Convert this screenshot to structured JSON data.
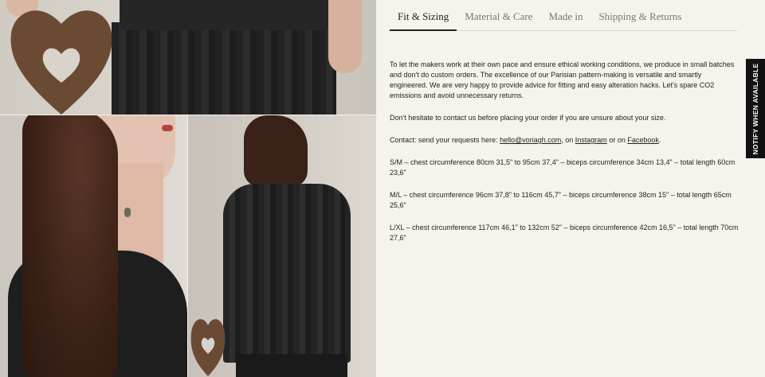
{
  "tabs": [
    {
      "label": "Fit & Sizing"
    },
    {
      "label": "Material & Care"
    },
    {
      "label": "Made in"
    },
    {
      "label": "Shipping & Returns"
    }
  ],
  "content": {
    "intro": "To let the makers work at their own pace and ensure ethical working conditions, we produce in small batches and don't do custom orders. The excellence of our Parisian pattern-making is versatile and smartly engineered. We are very happy to provide advice for fitting and easy alteration hacks. Let's spare CO2 emissions and avoid unnecessary returns.",
    "hesitate": "Don't hesitate to contact us before placing your order if you are unsure about your size.",
    "contact": {
      "prefix": "Contact: send your requests here: ",
      "email": "hello@voriagh.com",
      "sep1": ", on ",
      "instagram": "Instagram",
      "sep2": " or on ",
      "facebook": "Facebook",
      "suffix": "."
    },
    "sizes": [
      "S/M – chest circumference 80cm 31,5\" to 95cm 37,4\" – biceps circumference 34cm 13,4\" – total length 60cm 23,6\"",
      "M/L – chest circumference 96cm 37,8\" to 116cm 45,7\" – biceps circumference 38cm 15\" – total length 65cm 25,6\"",
      "L/XL – chest circumference 117cm 46,1\" to 132cm 52\" – biceps circumference 42cm 16,5\" – total length 70cm 27,6\""
    ]
  },
  "notify": {
    "label": "NOTIFY WHEN AVAILABLE"
  },
  "colors": {
    "background": "#f6f3ec",
    "garment": "#222222",
    "notify_bg": "#111111"
  },
  "gallery": {
    "icons": [
      "wooden-heart-icon"
    ]
  }
}
